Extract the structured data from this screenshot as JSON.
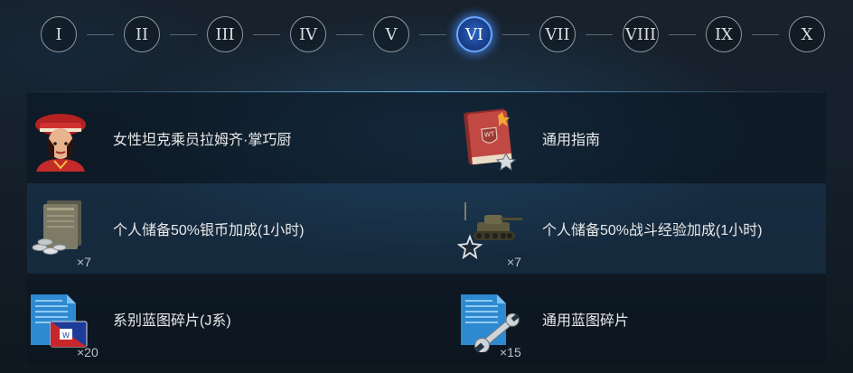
{
  "tier_selector": {
    "tiers": [
      "I",
      "II",
      "III",
      "IV",
      "V",
      "VI",
      "VII",
      "VIII",
      "IX",
      "X"
    ],
    "active_index": 5
  },
  "rewards": [
    {
      "left": {
        "icon": "crew-member-portrait",
        "label": "女性坦克乘员拉姆齐·掌巧厨",
        "quantity": ""
      },
      "right": {
        "icon": "universal-guide-book-icon",
        "label": "通用指南",
        "quantity": ""
      }
    },
    {
      "left": {
        "icon": "credits-booster-icon",
        "label": "个人储备50%银币加成(1小时)",
        "quantity": "×7"
      },
      "right": {
        "icon": "combat-xp-booster-icon",
        "label": "个人储备50%战斗经验加成(1小时)",
        "quantity": "×7"
      }
    },
    {
      "left": {
        "icon": "nation-blueprint-fragment-icon",
        "label": "系别蓝图碎片(J系)",
        "quantity": "×20"
      },
      "right": {
        "icon": "universal-blueprint-fragment-icon",
        "label": "通用蓝图碎片",
        "quantity": "×15"
      }
    }
  ],
  "colors": {
    "active_tier": "#2a66c8",
    "active_glow": "#6aa9ff",
    "tier_border": "#8d97a2",
    "background": "#141c26"
  }
}
